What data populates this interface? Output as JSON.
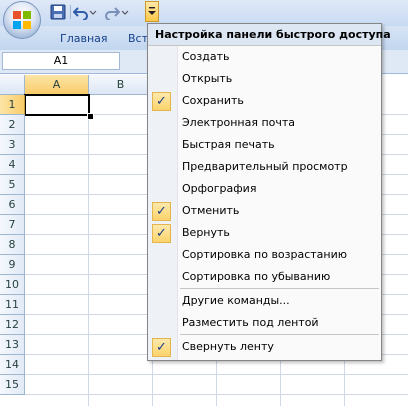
{
  "ribbon": {
    "tabs": [
      "Главная",
      "Вст"
    ]
  },
  "formula_bar": {
    "name_box": "A1"
  },
  "sheet": {
    "columns": [
      "A",
      "B"
    ],
    "rows": [
      "1",
      "2",
      "3",
      "4",
      "5",
      "6",
      "7",
      "8",
      "9",
      "10",
      "11",
      "12",
      "13",
      "14",
      "15"
    ],
    "active_cell": "A1"
  },
  "menu": {
    "title": "Настройка панели быстрого доступа",
    "items": [
      {
        "label": "Создать",
        "checked": false
      },
      {
        "label": "Открыть",
        "checked": false
      },
      {
        "label": "Сохранить",
        "checked": true
      },
      {
        "label": "Электронная почта",
        "checked": false
      },
      {
        "label": "Быстрая печать",
        "checked": false
      },
      {
        "label": "Предварительный просмотр",
        "checked": false
      },
      {
        "label": "Орфография",
        "checked": false
      },
      {
        "label": "Отменить",
        "checked": true
      },
      {
        "label": "Вернуть",
        "checked": true
      },
      {
        "label": "Сортировка по возрастанию",
        "checked": false
      },
      {
        "label": "Сортировка по убыванию",
        "checked": false
      },
      {
        "label": "Другие команды...",
        "checked": false
      },
      {
        "label": "Разместить под лентой",
        "checked": false
      },
      {
        "label": "Свернуть ленту",
        "checked": true
      }
    ],
    "check_glyph": "✓"
  },
  "icons": [
    "office-button-icon",
    "save-icon",
    "undo-icon",
    "redo-icon",
    "customize-dropdown-icon"
  ],
  "colors": {
    "accent": "#15428b",
    "highlight": "#fbd36c"
  }
}
